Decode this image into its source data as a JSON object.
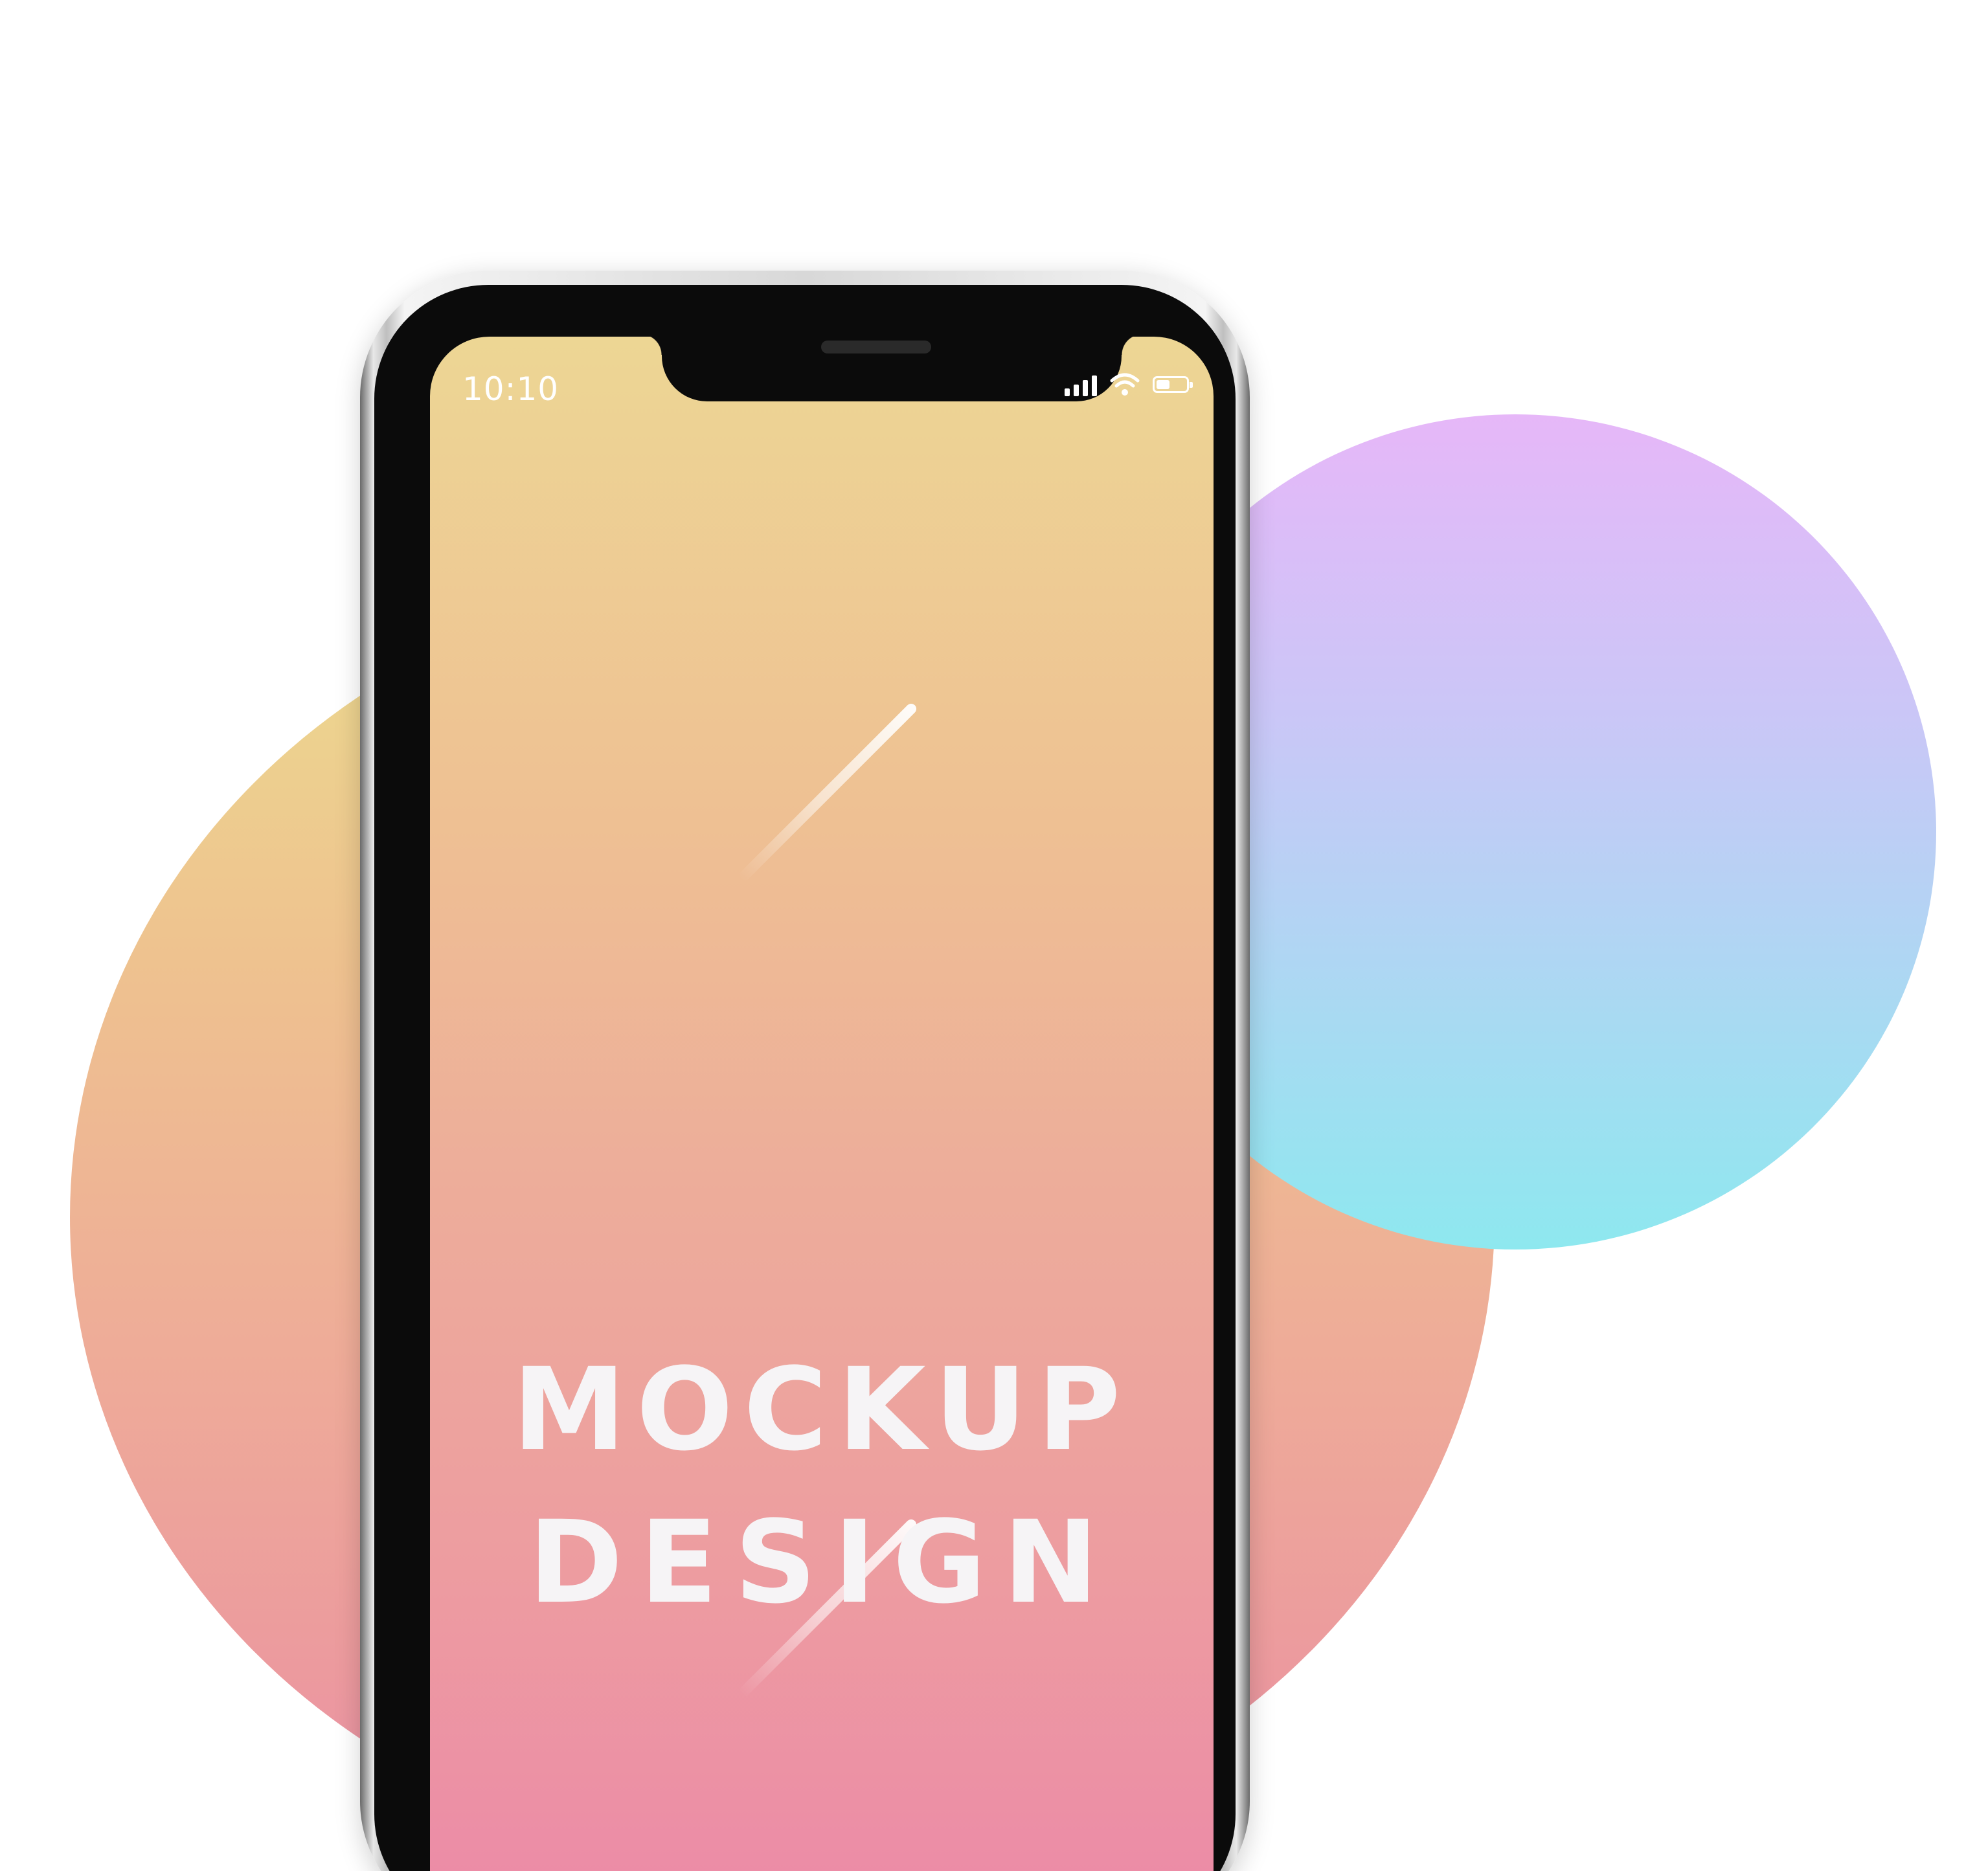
{
  "status_bar": {
    "time": "10:10",
    "icons": [
      "signal-icon",
      "wifi-icon",
      "battery-icon"
    ],
    "battery_level": 0.45
  },
  "screen": {
    "title_line1": "MOCKUP",
    "title_line2": "DESIGN"
  },
  "colors": {
    "screen_gradient_top": "#edd694",
    "screen_gradient_bottom": "#ec88a8",
    "big_circle_top": "#ecdc8f",
    "big_circle_bottom": "#e98fa8",
    "small_circle_top": "#e6b7f8",
    "small_circle_bottom": "#8ee8ef",
    "title_text": "#f6f4f6",
    "phone_bezel": "#0b0b0b"
  }
}
